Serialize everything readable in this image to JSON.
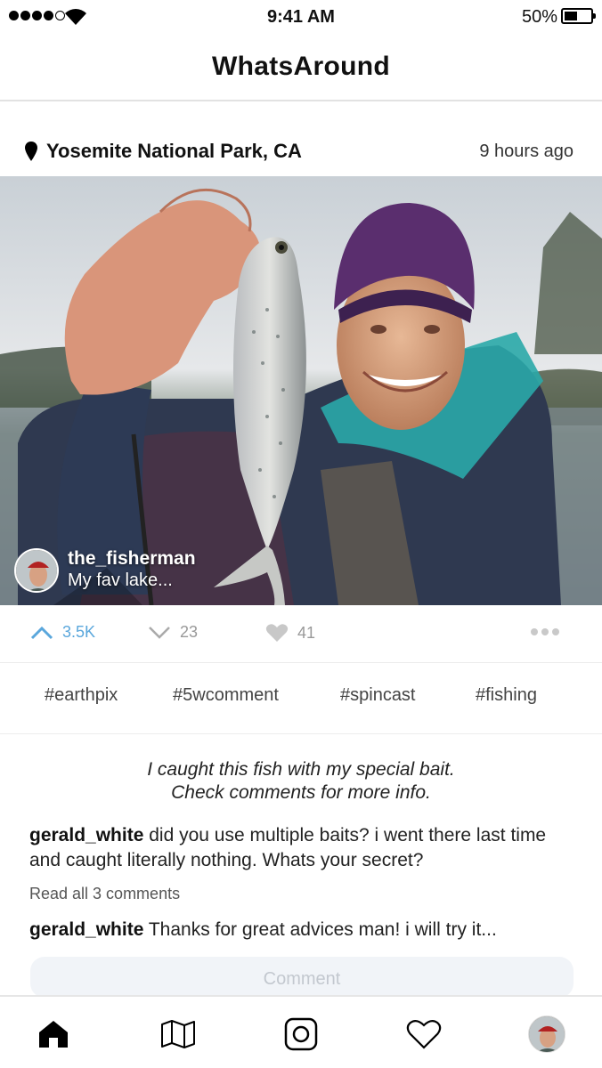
{
  "status_bar": {
    "time": "9:41 AM",
    "battery_percent": "50%",
    "battery_level": 0.5,
    "signal_bars_filled": 4,
    "signal_bars_total": 5
  },
  "app": {
    "title": "WhatsAround"
  },
  "post": {
    "location": "Yosemite National Park, CA",
    "time_ago": "9 hours ago",
    "owner": {
      "username": "the_fisherman",
      "caption": "My fav lake..."
    },
    "actions": {
      "upvotes": "3.5K",
      "downvotes": "23",
      "likes": "41"
    },
    "hashtags": [
      "#earthpix",
      "#5wcomment",
      "#spincast",
      "#fishing"
    ],
    "description": {
      "line1": "I caught this fish with my special bait.",
      "line2": "Check comments for more info."
    },
    "comments": [
      {
        "user": "gerald_white",
        "text": "did you use multiple baits? i went there last time and caught literally nothing. Whats your secret?"
      },
      {
        "user": "gerald_white",
        "text": "Thanks for great advices man! i will try it..."
      }
    ],
    "read_all_label": "Read all 3 comments",
    "comment_placeholder": "Comment"
  },
  "tab_bar": {
    "items": [
      {
        "icon": "home-icon",
        "active": true
      },
      {
        "icon": "map-icon"
      },
      {
        "icon": "camera-icon"
      },
      {
        "icon": "heart-icon"
      },
      {
        "icon": "profile-avatar"
      }
    ]
  },
  "colors": {
    "accent": "#5aa7dc",
    "muted": "#999999",
    "input_bg": "#f1f4f8"
  }
}
